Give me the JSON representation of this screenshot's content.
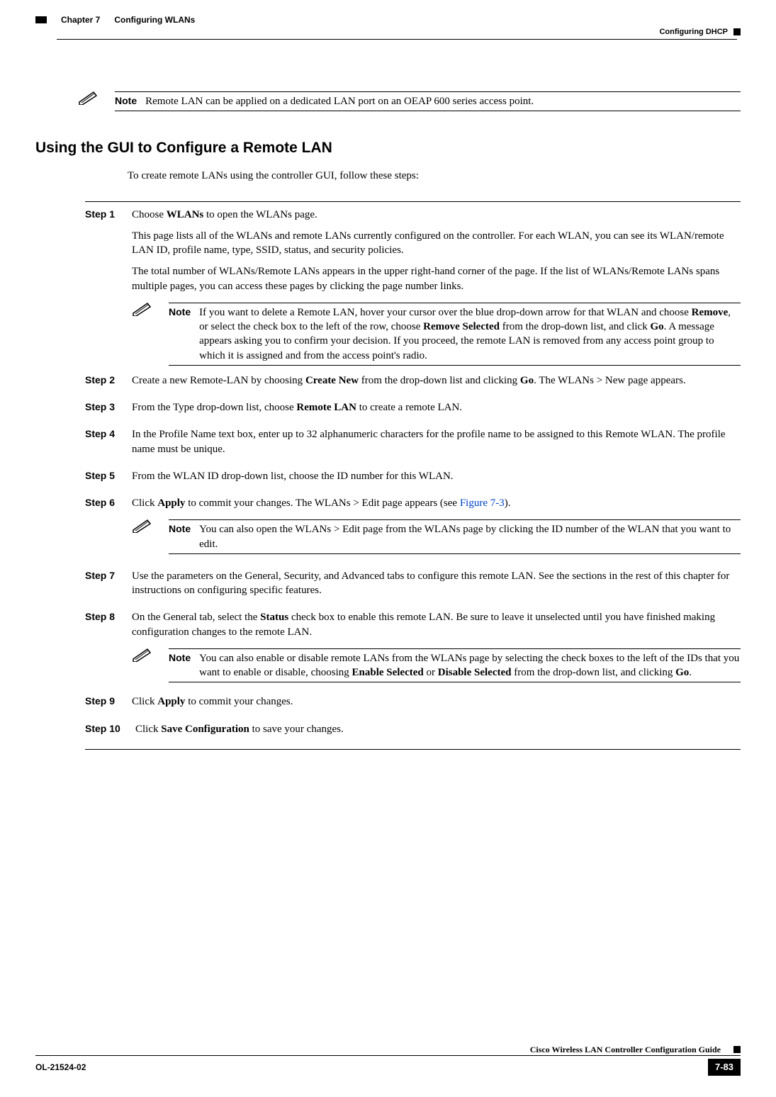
{
  "header": {
    "chapter": "Chapter 7",
    "title": "Configuring WLANs",
    "right": "Configuring DHCP"
  },
  "note_top": {
    "label": "Note",
    "text": "Remote LAN can be applied on a dedicated LAN port on an OEAP 600 series access point."
  },
  "section_heading": "Using the GUI to Configure a Remote LAN",
  "intro": "To create remote LANs using the controller GUI, follow these steps:",
  "step1": {
    "label": "Step 1",
    "p1a": "Choose ",
    "p1b": "WLANs",
    "p1c": " to open the WLANs page.",
    "p2": "This page lists all of the WLANs and remote LANs currently configured on the controller. For each WLAN, you can see its WLAN/remote LAN ID, profile name, type, SSID, status, and security policies.",
    "p3": "The total number of WLANs/Remote LANs appears in the upper right-hand corner of the page. If the list of WLANs/Remote LANs spans multiple pages, you can access these pages by clicking the page number links.",
    "note_label": "Note",
    "note_a": "If you want to delete a Remote LAN, hover your cursor over the blue drop-down arrow for that WLAN and choose ",
    "note_b1": "Remove",
    "note_c": ", or select the check box to the left of the row, choose ",
    "note_b2": "Remove Selected",
    "note_d": " from the drop-down list, and click ",
    "note_b3": "Go",
    "note_e": ". A message appears asking you to confirm your decision. If you proceed, the remote LAN is removed from any access point group to which it is assigned and from the access point's radio."
  },
  "step2": {
    "label": "Step 2",
    "a": "Create a new Remote-LAN by choosing ",
    "b1": "Create New",
    "c": " from the drop-down list and clicking ",
    "b2": "Go",
    "d": ". The WLANs > New page appears."
  },
  "step3": {
    "label": "Step 3",
    "a": "From the Type drop-down list, choose ",
    "b": "Remote LAN",
    "c": " to create a remote LAN."
  },
  "step4": {
    "label": "Step 4",
    "text": "In the Profile Name text box, enter up to 32 alphanumeric characters for the profile name to be assigned to this Remote WLAN. The profile name must be unique."
  },
  "step5": {
    "label": "Step 5",
    "text": "From the WLAN ID drop-down list, choose the ID number for this WLAN."
  },
  "step6": {
    "label": "Step 6",
    "a": "Click ",
    "b": "Apply",
    "c": " to commit your changes. The WLANs > Edit page appears (see ",
    "link": "Figure 7-3",
    "d": ").",
    "note_label": "Note",
    "note_text": "You can also open the WLANs > Edit page from the WLANs page by clicking the ID number of the WLAN that you want to edit."
  },
  "step7": {
    "label": "Step 7",
    "text": "Use the parameters on the General, Security, and Advanced tabs to configure this remote LAN. See the sections in the rest of this chapter for instructions on configuring specific features."
  },
  "step8": {
    "label": "Step 8",
    "a": "On the General tab, select the ",
    "b": "Status",
    "c": " check box to enable this remote LAN. Be sure to leave it unselected until you have finished making configuration changes to the remote LAN.",
    "note_label": "Note",
    "note_a": "You can also enable or disable remote LANs from the WLANs page by selecting the check boxes to the left of the IDs that you want to enable or disable, choosing ",
    "note_b1": "Enable Selected",
    "note_m": " or ",
    "note_b2": "Disable Selected",
    "note_c": " from the drop-down list, and clicking ",
    "note_b3": "Go",
    "note_d": "."
  },
  "step9": {
    "label": "Step 9",
    "a": "Click ",
    "b": "Apply",
    "c": " to commit your changes."
  },
  "step10": {
    "label": "Step 10",
    "a": "Click ",
    "b": "Save Configuration",
    "c": " to save your changes."
  },
  "footer": {
    "booktitle": "Cisco Wireless LAN Controller Configuration Guide",
    "docnum": "OL-21524-02",
    "pagenum": "7-83"
  }
}
